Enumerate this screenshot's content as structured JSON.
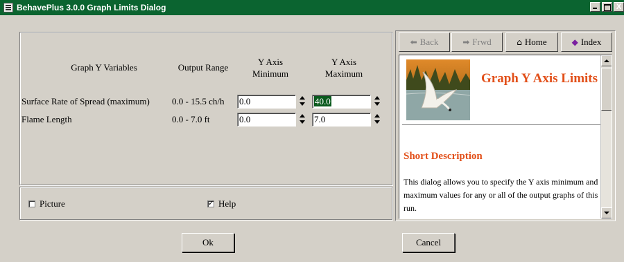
{
  "window": {
    "title": "BehavePlus 3.0.0 Graph Limits Dialog",
    "controls": {
      "minimize": "",
      "maximize": "",
      "close": "X"
    }
  },
  "table": {
    "headers": {
      "variables": "Graph Y Variables",
      "range": "Output Range",
      "ymin": "Y Axis Minimum",
      "ymax": "Y Axis Maximum"
    },
    "rows": [
      {
        "variable": "Surface Rate of Spread (maximum)",
        "range": "0.0 - 15.5 ch/h",
        "min": "0.0",
        "max": "40.0"
      },
      {
        "variable": "Flame Length",
        "range": "0.0 - 7.0 ft",
        "min": "0.0",
        "max": "7.0"
      }
    ]
  },
  "options": {
    "picture": {
      "label": "Picture",
      "checked": false
    },
    "help": {
      "label": "Help",
      "checked": true,
      "mark": "✓"
    }
  },
  "help": {
    "nav": {
      "back": "Back",
      "forward": "Frwd",
      "home": "Home",
      "index": "Index"
    },
    "title": "Graph Y Axis Limits",
    "subtitle": "Short Description",
    "text": "This dialog allows you to specify the Y axis minimum and maximum values for any or all of the output graphs of this run."
  },
  "buttons": {
    "ok": "Ok",
    "cancel": "Cancel"
  },
  "colors": {
    "titlebar": "#0b6430",
    "dialog": "#d4d0c8",
    "help_heading": "#e2501a",
    "selection": "#0a5a1e"
  }
}
